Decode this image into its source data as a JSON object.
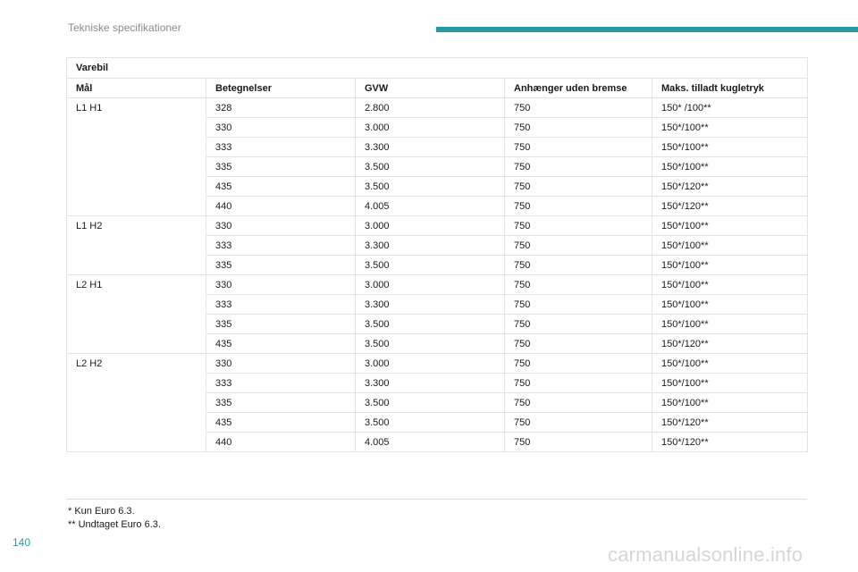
{
  "header": {
    "title": "Tekniske specifikationer",
    "accent_color": "#2a9aa0"
  },
  "table": {
    "section_label": "Varebil",
    "columns": [
      "Mål",
      "Betegnelser",
      "GVW",
      "Anhænger uden bremse",
      "Maks. tilladt kugletryk"
    ],
    "groups": [
      {
        "label": "L1 H1",
        "rows": [
          [
            "328",
            "2.800",
            "750",
            "150* /100**"
          ],
          [
            "330",
            "3.000",
            "750",
            "150*/100**"
          ],
          [
            "333",
            "3.300",
            "750",
            "150*/100**"
          ],
          [
            "335",
            "3.500",
            "750",
            "150*/100**"
          ],
          [
            "435",
            "3.500",
            "750",
            "150*/120**"
          ],
          [
            "440",
            "4.005",
            "750",
            "150*/120**"
          ]
        ]
      },
      {
        "label": "L1 H2",
        "rows": [
          [
            "330",
            "3.000",
            "750",
            "150*/100**"
          ],
          [
            "333",
            "3.300",
            "750",
            "150*/100**"
          ],
          [
            "335",
            "3.500",
            "750",
            "150*/100**"
          ]
        ]
      },
      {
        "label": "L2 H1",
        "rows": [
          [
            "330",
            "3.000",
            "750",
            "150*/100**"
          ],
          [
            "333",
            "3.300",
            "750",
            "150*/100**"
          ],
          [
            "335",
            "3.500",
            "750",
            "150*/100**"
          ],
          [
            "435",
            "3.500",
            "750",
            "150*/120**"
          ]
        ]
      },
      {
        "label": "L2 H2",
        "rows": [
          [
            "330",
            "3.000",
            "750",
            "150*/100**"
          ],
          [
            "333",
            "3.300",
            "750",
            "150*/100**"
          ],
          [
            "335",
            "3.500",
            "750",
            "150*/100**"
          ],
          [
            "435",
            "3.500",
            "750",
            "150*/120**"
          ],
          [
            "440",
            "4.005",
            "750",
            "150*/120**"
          ]
        ]
      }
    ]
  },
  "footnotes": [
    "* Kun Euro 6.3.",
    "** Undtaget Euro 6.3."
  ],
  "page_number": "140",
  "watermark": "carmanualsonline.info"
}
